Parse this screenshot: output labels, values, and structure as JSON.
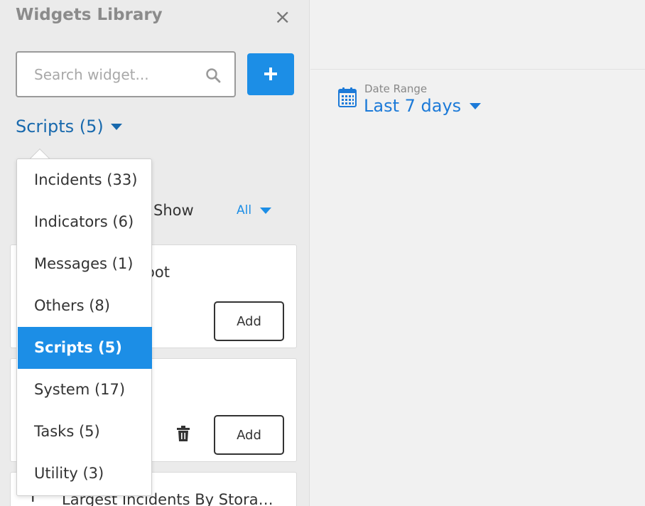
{
  "panel": {
    "title": "Widgets Library",
    "close_icon": "close-icon",
    "search": {
      "placeholder": "Search widget...",
      "value": ""
    },
    "add_icon": "plus-icon",
    "category": {
      "label": "Scripts (5)"
    },
    "show": {
      "label": "Show",
      "value": "All"
    }
  },
  "dropdown": {
    "items": [
      {
        "label": "Incidents (33)"
      },
      {
        "label": "Indicators (6)"
      },
      {
        "label": "Messages (1)"
      },
      {
        "label": "Others (8)"
      },
      {
        "label": "Scripts (5)",
        "selected": true
      },
      {
        "label": "System (17)"
      },
      {
        "label": "Tasks (5)"
      },
      {
        "label": "Utility (3)"
      }
    ]
  },
  "cards": [
    {
      "name_visible": "oot",
      "add_label": "Add"
    },
    {
      "bracket": "]",
      "add_label": "Add"
    },
    {
      "name": "Largest Incidents By Stora…"
    }
  ],
  "date_range": {
    "label": "Date Range",
    "value": "Last 7 days"
  },
  "colors": {
    "accent": "#1c8ee6",
    "link": "#1869ad",
    "panel_bg": "#ebebeb",
    "canvas_bg": "#f1f1f1"
  }
}
